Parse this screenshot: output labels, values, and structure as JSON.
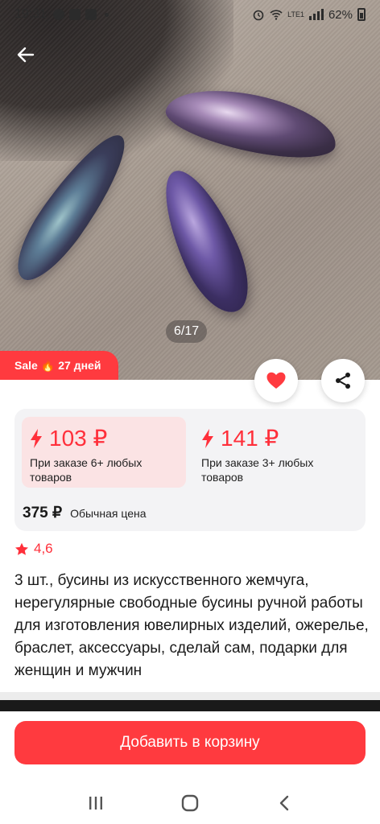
{
  "status_bar": {
    "time": "19:31",
    "network": "LTE1",
    "battery": "62%"
  },
  "gallery": {
    "counter": "6/17"
  },
  "promo": {
    "sale_label": "Sale",
    "days": "27 дней"
  },
  "price_tiers": [
    {
      "price": "103 ₽",
      "condition": "При заказе 6+ любых товаров"
    },
    {
      "price": "141 ₽",
      "condition": "При заказе 3+ любых товаров"
    }
  ],
  "regular_price": {
    "price": "375 ₽",
    "label": "Обычная цена"
  },
  "rating": "4,6",
  "product_title": "3 шт., бусины из искусственного жемчуга, нерегулярные свободные бусины ручной работы для изготовления ювелирных изделий, ожерелье, браслет, аксессуары, сделай сам, подарки для женщин и мужчин",
  "actions": {
    "add_to_cart": "Добавить в корзину"
  },
  "colors": {
    "accent": "#ff3a3f",
    "tier_active_bg": "#fbe3e4",
    "card_bg": "#f3f3f5"
  },
  "icons": [
    "back-arrow-icon",
    "heart-icon",
    "share-icon",
    "lightning-icon",
    "star-icon",
    "fire-icon",
    "recent-apps-icon",
    "home-icon",
    "back-nav-icon"
  ]
}
